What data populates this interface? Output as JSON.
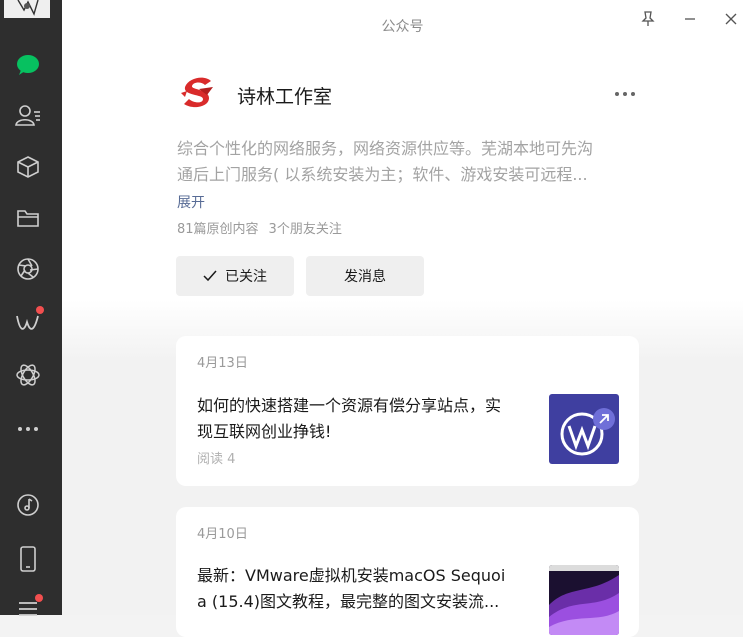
{
  "window": {
    "title": "公众号",
    "pin_icon": "pin-icon",
    "minimize_icon": "minimize-icon",
    "close_icon": "close-icon"
  },
  "sidebar": {
    "items": [
      {
        "name": "chats",
        "icon": "chat-bubble-icon",
        "active": true
      },
      {
        "name": "contacts",
        "icon": "contacts-icon"
      },
      {
        "name": "favorites",
        "icon": "cube-icon"
      },
      {
        "name": "files",
        "icon": "folder-icon"
      },
      {
        "name": "moments",
        "icon": "aperture-icon"
      },
      {
        "name": "channels",
        "icon": "channels-icon",
        "badge": true
      },
      {
        "name": "mini-programs",
        "icon": "mini-program-icon"
      },
      {
        "name": "more",
        "icon": "more-icon"
      },
      {
        "name": "music",
        "icon": "music-icon"
      },
      {
        "name": "phone",
        "icon": "phone-icon"
      },
      {
        "name": "menu",
        "icon": "menu-icon",
        "badge": true
      }
    ],
    "accent_color": "#07c160"
  },
  "account": {
    "name": "诗林工作室",
    "description_line1": "综合个性化的网络服务，网络资源供应等。芜湖本地可先沟",
    "description_line2": "通后上门服务( 以系统安装为主；软件、游戏安装可远程...",
    "expand_label": "展开",
    "original_count": "81篇原创内容",
    "friends_following": "3个朋友关注",
    "followed_label": "已关注",
    "message_label": "发消息"
  },
  "articles": [
    {
      "date": "4月13日",
      "title_line1": "如何的快速搭建一个资源有偿分享站点，实",
      "title_line2": "现互联网创业挣钱!",
      "reads": "阅读 4",
      "thumb_icon": "wordpress-icon"
    },
    {
      "date": "4月10日",
      "title_line1": "最新：VMware虚拟机安装macOS Sequoi",
      "title_line2": "a (15.4)图文教程，最完整的图文安装流...",
      "thumb_icon": "macos-wallpaper"
    }
  ]
}
